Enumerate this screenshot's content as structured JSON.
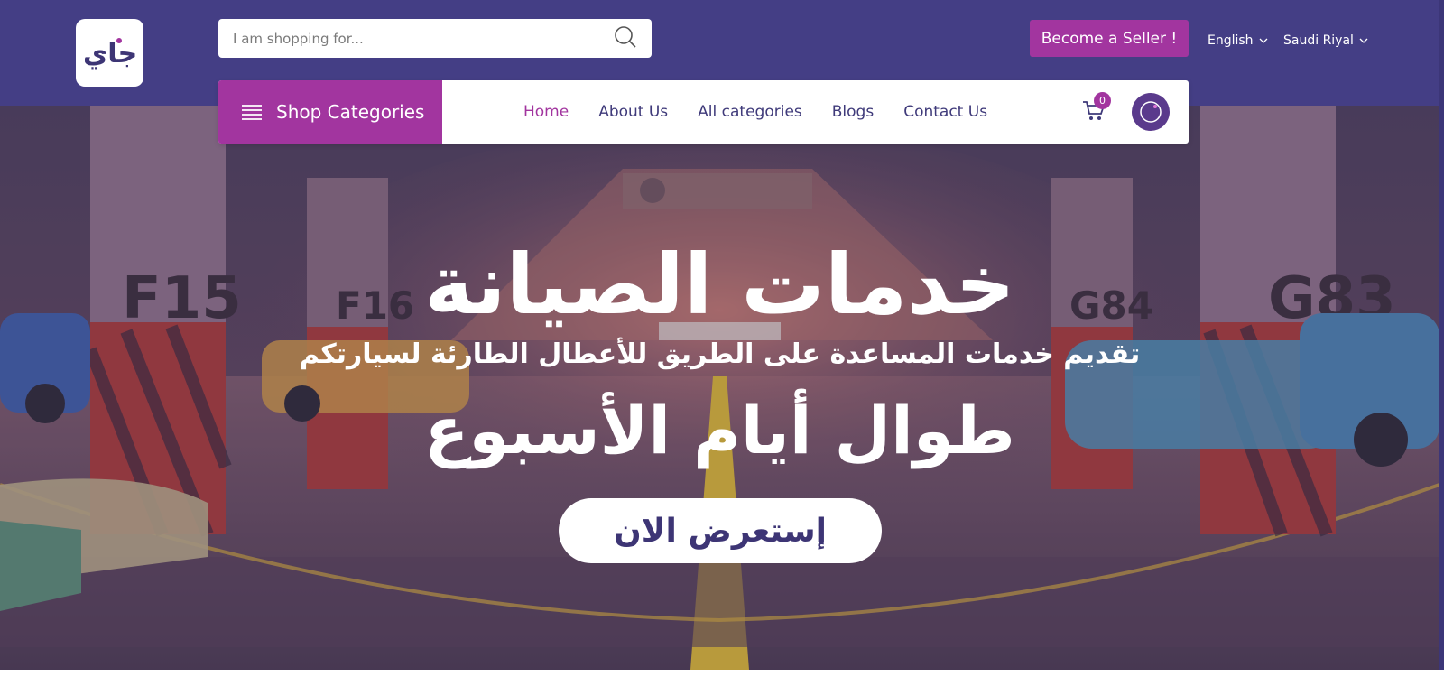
{
  "brand": {
    "logo_text": "جاي"
  },
  "search": {
    "placeholder": "I am shopping for..."
  },
  "header": {
    "seller_button": "Become a Seller !",
    "language": "English",
    "currency": "Saudi Riyal"
  },
  "nav": {
    "shop_categories": "Shop Categories",
    "items": [
      {
        "label": "Home",
        "active": true
      },
      {
        "label": "About Us"
      },
      {
        "label": "All categories"
      },
      {
        "label": "Blogs"
      },
      {
        "label": "Contact Us"
      }
    ],
    "cart_count": "0"
  },
  "hero": {
    "title": "خدمات الصيانة",
    "subtitle": "تقديم خدمات المساعدة على الطريق للأعطال الطارئة لسيارتكم",
    "tagline": "طوال أيام الأسبوع",
    "cta": "إستعرض الان",
    "signs": [
      "F15",
      "F16",
      "G84",
      "G83"
    ]
  },
  "colors": {
    "header_bg": "#443e85",
    "accent": "#a2359f",
    "nav_text": "#3f3a7a"
  },
  "icons": [
    "search-icon",
    "chevron-down-icon",
    "hamburger-icon",
    "cart-icon",
    "avatar"
  ]
}
